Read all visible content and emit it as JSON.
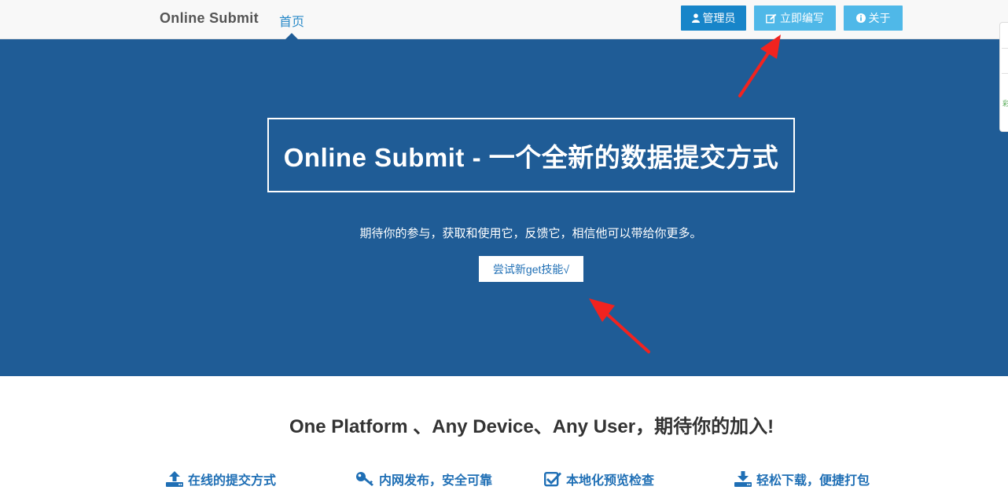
{
  "navbar": {
    "brand": "Online Submit",
    "home_label": "首页",
    "admin_button": "管理员",
    "write_button": "立即编写",
    "about_button": "关于"
  },
  "side_widget": {
    "glyph": "彩"
  },
  "hero": {
    "title": "Online Submit - 一个全新的数据提交方式",
    "subtitle": "期待你的参与，获取和使用它，反馈它，相信他可以带给你更多。",
    "cta_button": "尝试新get技能√"
  },
  "tagline": "One Platform 、Any Device、Any User，期待你的加入!",
  "features": [
    {
      "label": "在线的提交方式",
      "icon": "upload-icon"
    },
    {
      "label": "内网发布，安全可靠",
      "icon": "key-icon"
    },
    {
      "label": "本地化预览检查",
      "icon": "check-square-icon"
    },
    {
      "label": "轻松下载，便捷打包",
      "icon": "download-icon"
    }
  ],
  "colors": {
    "navbar_bg": "#f8f8f8",
    "hero_bg": "#1f5c96",
    "primary_button": "#1785c9",
    "info_button": "#4fb8e8",
    "link": "#2a8ac8",
    "feature_text": "#1f6fb5",
    "annotation_arrow": "#f2231f"
  }
}
